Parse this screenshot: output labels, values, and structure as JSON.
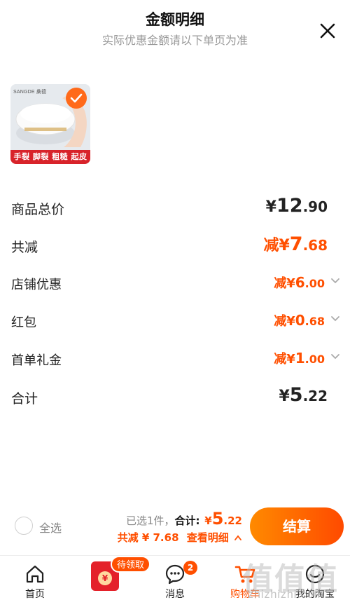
{
  "header": {
    "title": "金额明细",
    "subtitle": "实际优惠金额请以下单页为准"
  },
  "product": {
    "brand": "SANGDE 桑德",
    "banner": "手裂 脚裂 粗糙 起皮",
    "selected": true
  },
  "rows": [
    {
      "label": "商品总价",
      "prefix": "",
      "currency": "¥",
      "integer": "12",
      "decimal": ".90",
      "color": "#222222",
      "chevron": false
    },
    {
      "label": "共减",
      "prefix": "减",
      "currency": "¥",
      "integer": "7",
      "decimal": ".68",
      "color": "#ff4f00",
      "chevron": false
    },
    {
      "label": "店铺优惠",
      "prefix": "减",
      "currency": "¥",
      "integer": "6",
      "decimal": ".00",
      "color": "#ff4f00",
      "chevron": true
    },
    {
      "label": "红包",
      "prefix": "减",
      "currency": "¥",
      "integer": "0",
      "decimal": ".68",
      "color": "#ff4f00",
      "chevron": true
    },
    {
      "label": "首单礼金",
      "prefix": "减",
      "currency": "¥",
      "integer": "1",
      "decimal": ".00",
      "color": "#ff4f00",
      "chevron": true
    },
    {
      "label": "合计",
      "prefix": "",
      "currency": "¥",
      "integer": "5",
      "decimal": ".22",
      "color": "#222222",
      "chevron": false
    }
  ],
  "footer": {
    "select_all": "全选",
    "selected_text": "已选1件，",
    "total_label": "合计:",
    "total_currency": "¥",
    "total_integer": "5",
    "total_decimal": ".22",
    "discount_text": "共减 ¥ 7.68",
    "detail_link": "查看明细",
    "checkout_label": "结算"
  },
  "tabbar": {
    "items": [
      {
        "label": "首页",
        "icon": "home-icon"
      },
      {
        "label": "",
        "icon": "red-packet-icon",
        "pill": "待领取"
      },
      {
        "label": "消息",
        "icon": "message-icon",
        "badge": "2"
      },
      {
        "label": "购物车",
        "icon": "cart-icon"
      },
      {
        "label": "我的淘宝",
        "icon": "profile-icon"
      }
    ]
  },
  "watermark": {
    "text": "值值值",
    "url": "zhizhizhi.com"
  },
  "colors": {
    "accent": "#ff4f00",
    "checkout_gradient_start": "#ff8a00",
    "checkout_gradient_end": "#ff4a00",
    "brand_red": "#d8232a"
  }
}
